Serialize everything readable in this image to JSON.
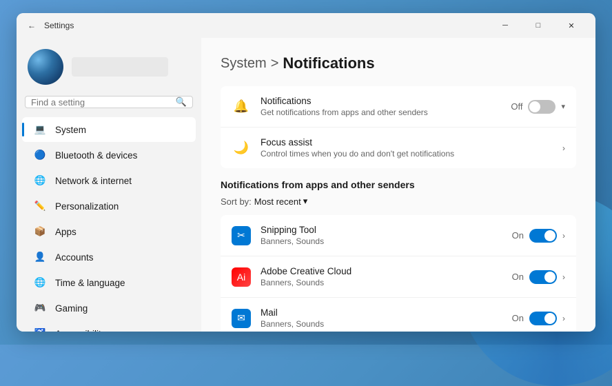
{
  "window": {
    "title": "Settings",
    "back_btn": "←",
    "min_btn": "─",
    "max_btn": "□",
    "close_btn": "✕"
  },
  "sidebar": {
    "search_placeholder": "Find a setting",
    "nav_items": [
      {
        "id": "system",
        "label": "System",
        "icon": "system",
        "active": true
      },
      {
        "id": "bluetooth",
        "label": "Bluetooth & devices",
        "icon": "bluetooth",
        "active": false
      },
      {
        "id": "network",
        "label": "Network & internet",
        "icon": "network",
        "active": false
      },
      {
        "id": "personalization",
        "label": "Personalization",
        "icon": "personalization",
        "active": false
      },
      {
        "id": "apps",
        "label": "Apps",
        "icon": "apps",
        "active": false
      },
      {
        "id": "accounts",
        "label": "Accounts",
        "icon": "accounts",
        "active": false
      },
      {
        "id": "time",
        "label": "Time & language",
        "icon": "time",
        "active": false
      },
      {
        "id": "gaming",
        "label": "Gaming",
        "icon": "gaming",
        "active": false
      },
      {
        "id": "accessibility",
        "label": "Accessibility",
        "icon": "accessibility",
        "active": false
      }
    ]
  },
  "main": {
    "breadcrumb_parent": "System",
    "breadcrumb_sep": ">",
    "breadcrumb_current": "Notifications",
    "top_settings": [
      {
        "id": "notifications",
        "title": "Notifications",
        "desc": "Get notifications from apps and other senders",
        "toggle": "off",
        "show_chevron_down": true
      },
      {
        "id": "focus-assist",
        "title": "Focus assist",
        "desc": "Control times when you do and don't get notifications",
        "show_chevron_right": true
      }
    ],
    "apps_section_title": "Notifications from apps and other senders",
    "sort_label": "Sort by:",
    "sort_value": "Most recent",
    "app_rows": [
      {
        "id": "snipping",
        "name": "Snipping Tool",
        "desc": "Banners, Sounds",
        "toggle": "on",
        "icon_type": "snipping"
      },
      {
        "id": "adobe",
        "name": "Adobe Creative Cloud",
        "desc": "Banners, Sounds",
        "toggle": "on",
        "icon_type": "adobe"
      },
      {
        "id": "mail",
        "name": "Mail",
        "desc": "Banners, Sounds",
        "toggle": "on",
        "icon_type": "mail"
      }
    ]
  }
}
